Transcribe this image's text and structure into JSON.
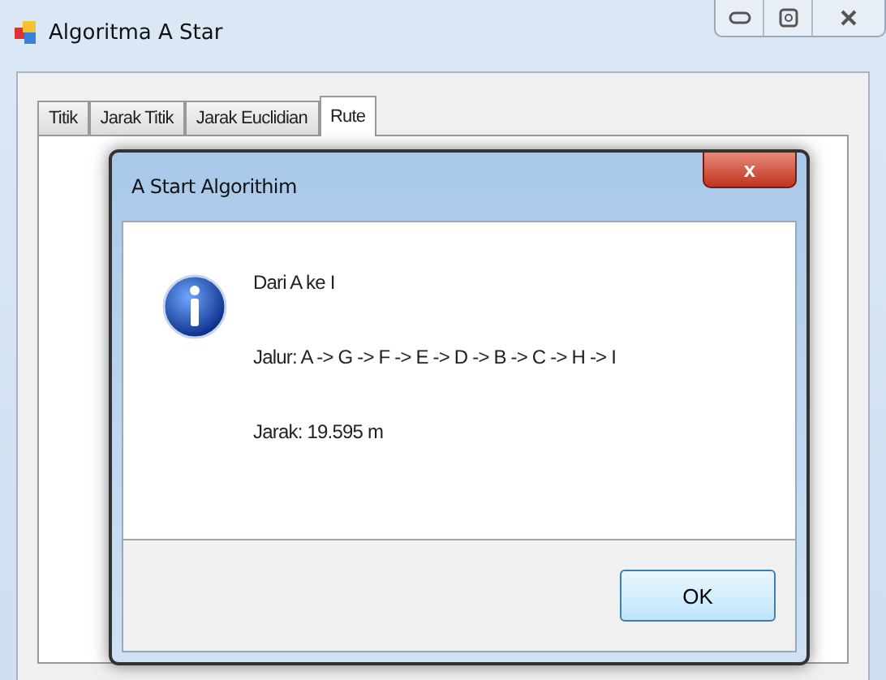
{
  "window": {
    "title": "Algoritma A Star"
  },
  "tabs": [
    {
      "label": "Titik",
      "selected": false
    },
    {
      "label": "Jarak Titik",
      "selected": false
    },
    {
      "label": "Jarak Euclidian",
      "selected": false
    },
    {
      "label": "Rute",
      "selected": true
    }
  ],
  "dialog": {
    "title": "A Start Algorithim",
    "close": "x",
    "lines": [
      "Dari A ke I",
      "Jalur: A -> G -> F -> E -> D -> B -> C -> H -> I",
      "Jarak: 19.595 m"
    ],
    "buttons": [
      "OK"
    ]
  }
}
